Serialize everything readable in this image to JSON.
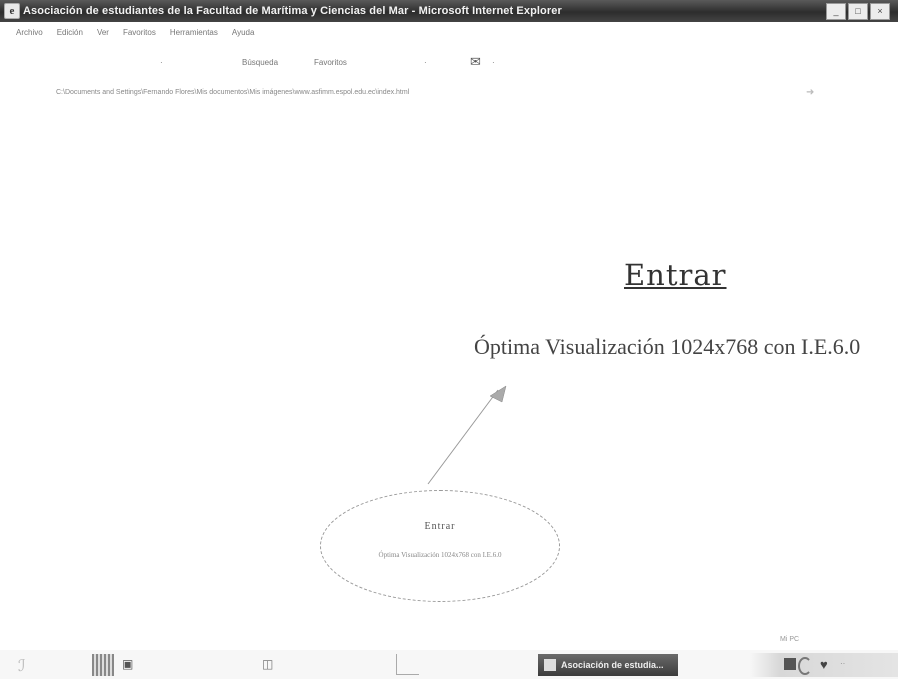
{
  "window": {
    "title": "Asociación de estudiantes de la Facultad de Marítima y Ciencias del Mar - Microsoft Internet Explorer",
    "icon": "ie-page-icon",
    "controls": [
      "_",
      "□",
      "×"
    ]
  },
  "menubar": {
    "items": [
      "Archivo",
      "Edición",
      "Ver",
      "Favoritos",
      "Herramientas",
      "Ayuda"
    ]
  },
  "toolbar": {
    "search_label": "Búsqueda",
    "favorites_label": "Favoritos",
    "mail_icon": "mail-icon"
  },
  "addressbar": {
    "url": "C:\\Documents and Settings\\Fernando Flores\\Mis documentos\\Mis imágenes\\www.asfimm.espol.edu.ec\\index.html",
    "go_icon": "go-arrow-icon"
  },
  "page": {
    "enter_link": "Entrar",
    "optima_text": "Óptima Visualización 1024x768 con I.E.6.0",
    "callout_enter": "Entrar",
    "callout_optima": "Óptima Visualización 1024x768 con I.E.6.0"
  },
  "statusbar": {
    "zone": "Mi PC"
  },
  "taskbar": {
    "active_task": "Asociación de estudia..."
  },
  "colors": {
    "titlebar": "#3a3a3a",
    "background": "#ffffff"
  }
}
